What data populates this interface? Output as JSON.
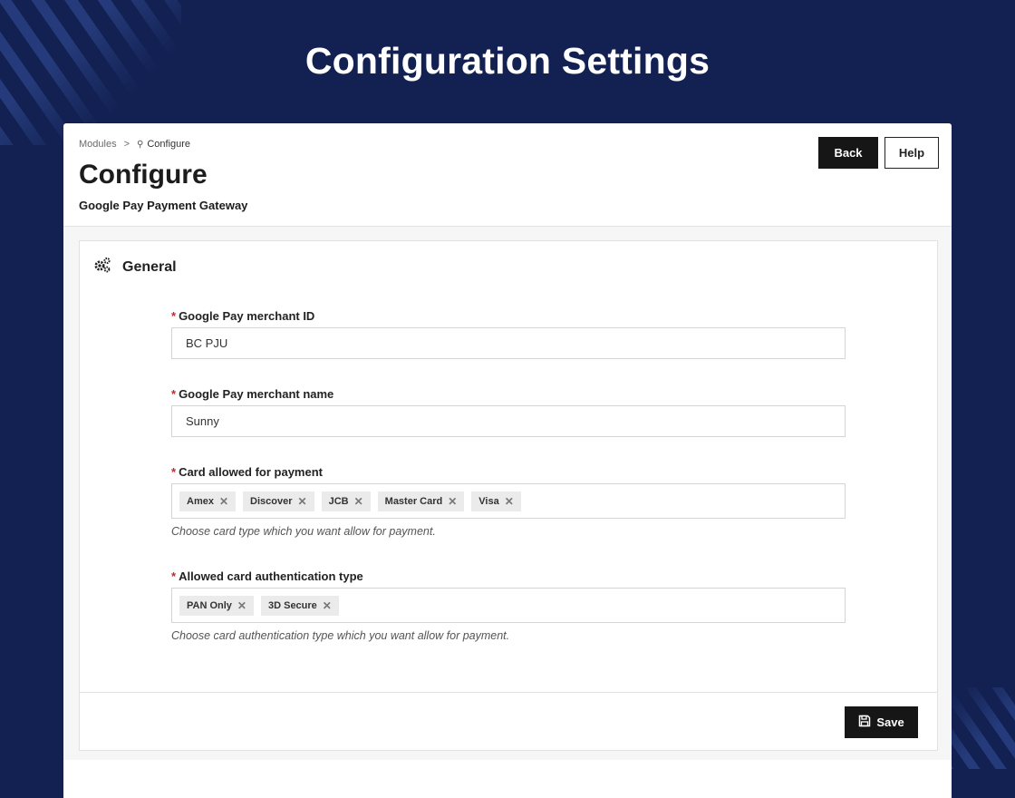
{
  "hero": {
    "title": "Configuration Settings"
  },
  "breadcrumb": {
    "root": "Modules",
    "separator": ">",
    "current": "Configure",
    "current_icon": "wrench-icon"
  },
  "header": {
    "title": "Configure",
    "subtitle": "Google Pay Payment Gateway",
    "back_label": "Back",
    "help_label": "Help"
  },
  "section": {
    "title": "General",
    "icon": "gears-icon"
  },
  "fields": {
    "merchant_id": {
      "required": "*",
      "label": "Google Pay merchant ID",
      "value": "BC PJU"
    },
    "merchant_name": {
      "required": "*",
      "label": "Google Pay merchant name",
      "value": "Sunny"
    },
    "cards": {
      "required": "*",
      "label": "Card allowed for payment",
      "tags": [
        "Amex",
        "Discover",
        "JCB",
        "Master Card",
        "Visa"
      ],
      "hint": "Choose card type which you want allow for payment."
    },
    "auth": {
      "required": "*",
      "label": "Allowed card authentication type",
      "tags": [
        "PAN Only",
        "3D Secure"
      ],
      "hint": "Choose card authentication type which you want allow for payment."
    }
  },
  "footer": {
    "save_label": "Save",
    "save_icon": "floppy-disk-icon"
  },
  "colors": {
    "background": "#132152",
    "primary_button": "#161616",
    "required": "#c62828"
  }
}
